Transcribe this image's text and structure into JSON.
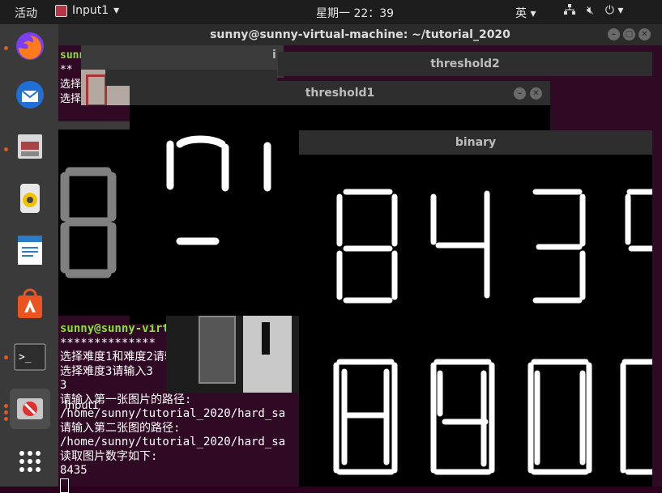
{
  "topbar": {
    "activities": "活动",
    "app_name": "Input1",
    "clock": "星期一 22：39",
    "input_method": "英"
  },
  "terminal": {
    "title": "sunny@sunny-virtual-machine: ~/tutorial_2020",
    "upper_lines": [
      "sunny",
      "**",
      "选择",
      "选择"
    ],
    "lines": {
      "l1": "sunny@sunny-virt",
      "l2": "**************",
      "l3": "选择难度1和难度2请输",
      "l4": "选择难度3请输入3",
      "l5": "3",
      "l6": "请输入第一张图片的路径:",
      "l7": "/home/sunny/tutorial_2020/hard_sa",
      "l8": "请输入第二张图的路径:",
      "l9": "/home/sunny/tutorial_2020/hard_sa",
      "l10": "读取图片数字如下:",
      "l11": "8435"
    }
  },
  "windows": {
    "threshold2": "threshold2",
    "threshold1": "threshold1",
    "binary": "binary",
    "input1_label": "Input1",
    "partial_title": "i"
  },
  "colors": {
    "accent": "#e95420",
    "terminal_bg": "#300a24"
  }
}
